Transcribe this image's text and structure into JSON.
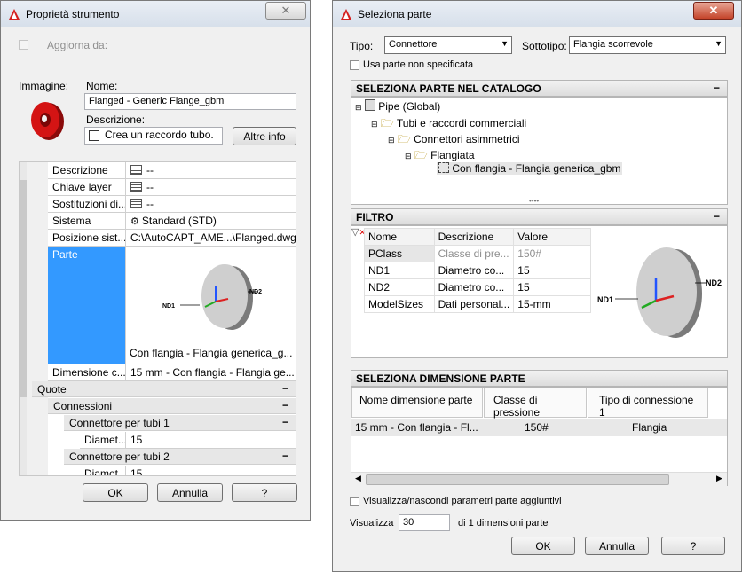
{
  "left_dialog": {
    "title": "Proprietà strumento",
    "update_from_label": "Aggiorna da:",
    "image_label": "Immagine:",
    "name_label": "Nome:",
    "name_value": "Flanged - Generic Flange_gbm",
    "description_label": "Descrizione:",
    "description_value": "Crea un raccordo tubo.",
    "more_info_button": "Altre info",
    "properties": [
      {
        "name": "Descrizione",
        "value": "--"
      },
      {
        "name": "Chiave layer",
        "value": "--"
      },
      {
        "name": "Sostituzioni di...",
        "value": "--"
      },
      {
        "name": "Sistema",
        "value": "Standard (STD)"
      },
      {
        "name": "Posizione sist...",
        "value": "C:\\AutoCAPT_AME...\\Flanged.dwg"
      },
      {
        "name": "Parte",
        "value": "Con flangia - Flangia generica_g..."
      },
      {
        "name": "Dimensione c...",
        "value": "15 mm - Con flangia - Flangia ge..."
      }
    ],
    "categories": {
      "quote": "Quote",
      "connessioni": "Connessioni",
      "connettore1": "Connettore per tubi 1",
      "connettore2": "Connettore per tubi 2"
    },
    "diam1_name": "Diamet...",
    "diam1_value": "15",
    "diam2_name": "Diamet...",
    "diam2_value": "15",
    "nd1": "ND1",
    "nd2": "ND2",
    "ok_button": "OK",
    "cancel_button": "Annulla",
    "help_button": "?"
  },
  "right_dialog": {
    "title": "Seleziona parte",
    "type_label": "Tipo:",
    "type_value": "Connettore",
    "subtype_label": "Sottotipo:",
    "subtype_value": "Flangia scorrevole",
    "unspecified_label": "Usa parte non specificata",
    "catalog_header": "SELEZIONA PARTE NEL CATALOGO",
    "tree": [
      "Pipe (Global)",
      "Tubi e raccordi commerciali",
      "Connettori asimmetrici",
      "Flangiata",
      "Con flangia - Flangia generica_gbm"
    ],
    "filter_header": "FILTRO",
    "filter_columns": [
      "Nome",
      "Descrizione",
      "Valore"
    ],
    "filter_rows": [
      [
        "PClass",
        "Classe di pre...",
        "150#"
      ],
      [
        "ND1",
        "Diametro co...",
        "15"
      ],
      [
        "ND2",
        "Diametro co...",
        "15"
      ],
      [
        "ModelSizes",
        "Dati personal...",
        "15-mm"
      ]
    ],
    "size_header": "SELEZIONA DIMENSIONE PARTE",
    "size_columns": [
      "Nome dimensione parte",
      "Classe di pressione",
      "Tipo di connessione 1"
    ],
    "size_rows": [
      [
        "15 mm - Con flangia - Fl...",
        "150#",
        "Flangia"
      ]
    ],
    "toggle_params_label": "Visualizza/nascondi parametri parte aggiuntivi",
    "show_label": "Visualizza",
    "show_value": "30",
    "show_suffix": "di 1 dimensioni parte",
    "nd1": "ND1",
    "nd2": "ND2",
    "ok_button": "OK",
    "cancel_button": "Annulla",
    "help_button": "?"
  },
  "colors": {
    "selection": "#3399ff",
    "flange_red": "#cc1111",
    "title_gradient_top": "#e9eef5"
  }
}
